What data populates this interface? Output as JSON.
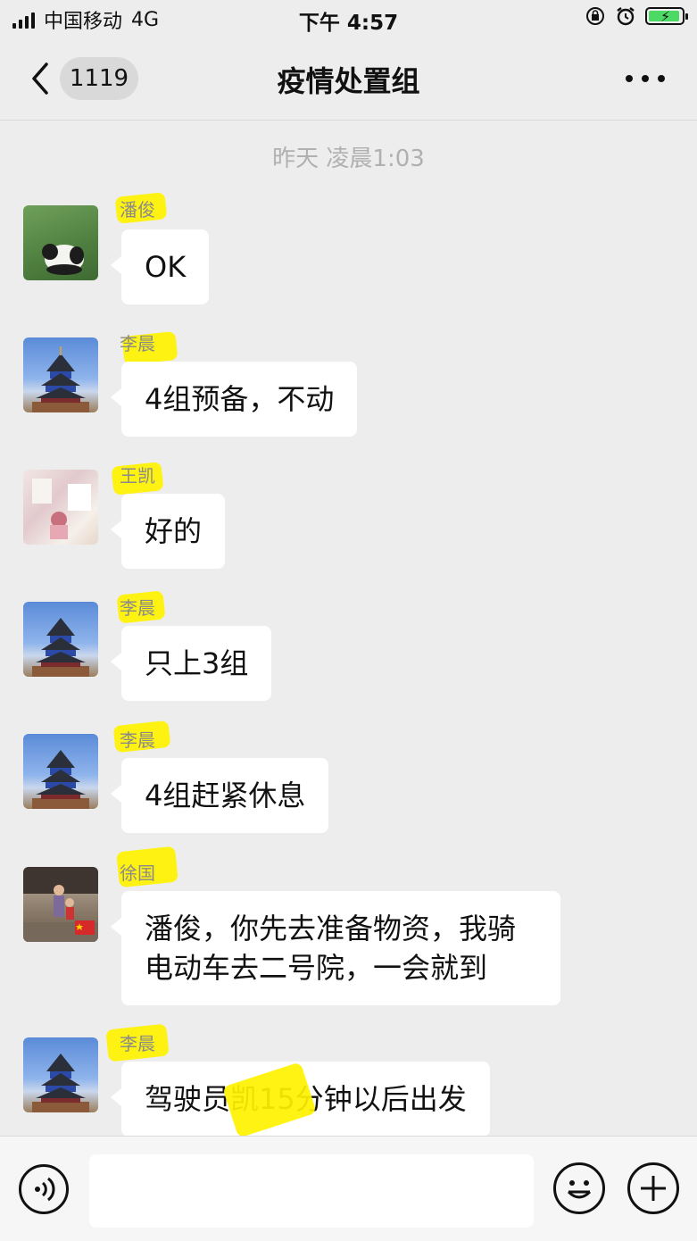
{
  "status_bar": {
    "carrier": "中国移动",
    "network": "4G",
    "time": "下午 4:57"
  },
  "nav": {
    "unread_count": "1119",
    "title": "疫情处置组"
  },
  "chat": {
    "timestamp": "昨天 凌晨1:03",
    "messages": [
      {
        "sender": "潘俊",
        "avatar": "panda-avatar",
        "text": "OK"
      },
      {
        "sender": "李晨",
        "avatar": "temple-avatar",
        "text": "4组预备，不动"
      },
      {
        "sender": "王凯",
        "avatar": "photo-avatar",
        "text": "好的"
      },
      {
        "sender": "李晨",
        "avatar": "temple-avatar",
        "text": "只上3组"
      },
      {
        "sender": "李晨",
        "avatar": "temple-avatar",
        "text": "4组赶紧休息"
      },
      {
        "sender": "徐国",
        "avatar": "family-avatar",
        "lines": [
          "潘俊，你先去准备物资，我骑",
          "电动车去二号院，一会就到"
        ]
      },
      {
        "sender": "李晨",
        "avatar": "temple-avatar",
        "text": "驾驶员凯15分钟以后出发"
      }
    ]
  },
  "colors": {
    "background": "#ededed",
    "bubble": "#ffffff",
    "highlight": "#fff200",
    "battery": "#4cd964"
  }
}
